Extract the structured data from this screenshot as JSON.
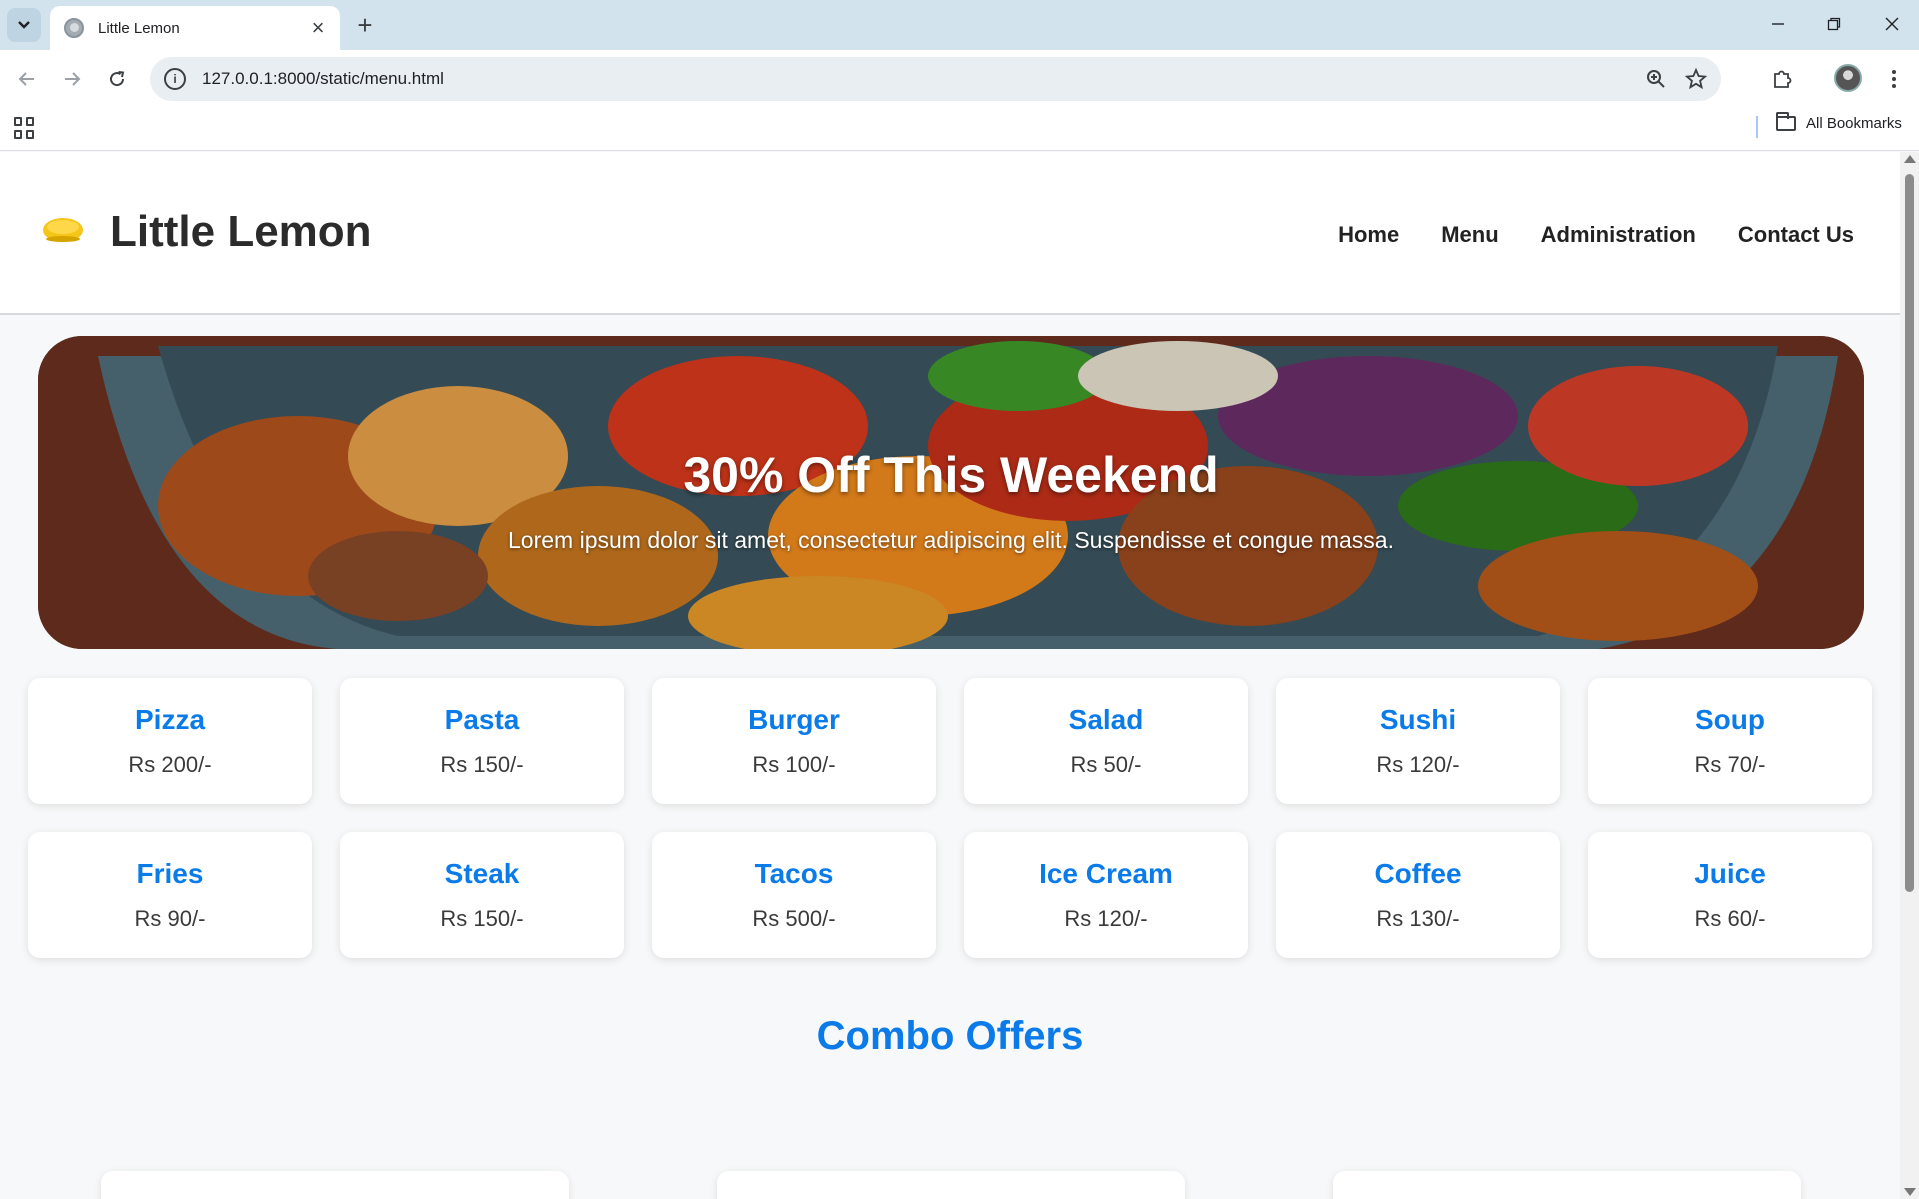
{
  "browser": {
    "tab_title": "Little Lemon",
    "url": "127.0.0.1:8000/static/menu.html",
    "all_bookmarks": "All Bookmarks"
  },
  "site": {
    "brand": "Little Lemon",
    "nav": [
      "Home",
      "Menu",
      "Administration",
      "Contact Us"
    ]
  },
  "hero": {
    "title": "30% Off This Weekend",
    "subtitle": "Lorem ipsum dolor sit amet, consectetur adipiscing elit. Suspendisse et congue massa."
  },
  "menu": [
    {
      "name": "Pizza",
      "price": "Rs 200/-"
    },
    {
      "name": "Pasta",
      "price": "Rs 150/-"
    },
    {
      "name": "Burger",
      "price": "Rs 100/-"
    },
    {
      "name": "Salad",
      "price": "Rs 50/-"
    },
    {
      "name": "Sushi",
      "price": "Rs 120/-"
    },
    {
      "name": "Soup",
      "price": "Rs 70/-"
    },
    {
      "name": "Fries",
      "price": "Rs 90/-"
    },
    {
      "name": "Steak",
      "price": "Rs 150/-"
    },
    {
      "name": "Tacos",
      "price": "Rs 500/-"
    },
    {
      "name": "Ice Cream",
      "price": "Rs 120/-"
    },
    {
      "name": "Coffee",
      "price": "Rs 130/-"
    },
    {
      "name": "Juice",
      "price": "Rs 60/-"
    }
  ],
  "combo": {
    "title": "Combo Offers"
  },
  "colors": {
    "accent": "#0a7be8",
    "page_bg": "#f7f8f9",
    "tabstrip": "#d3e3ee"
  }
}
